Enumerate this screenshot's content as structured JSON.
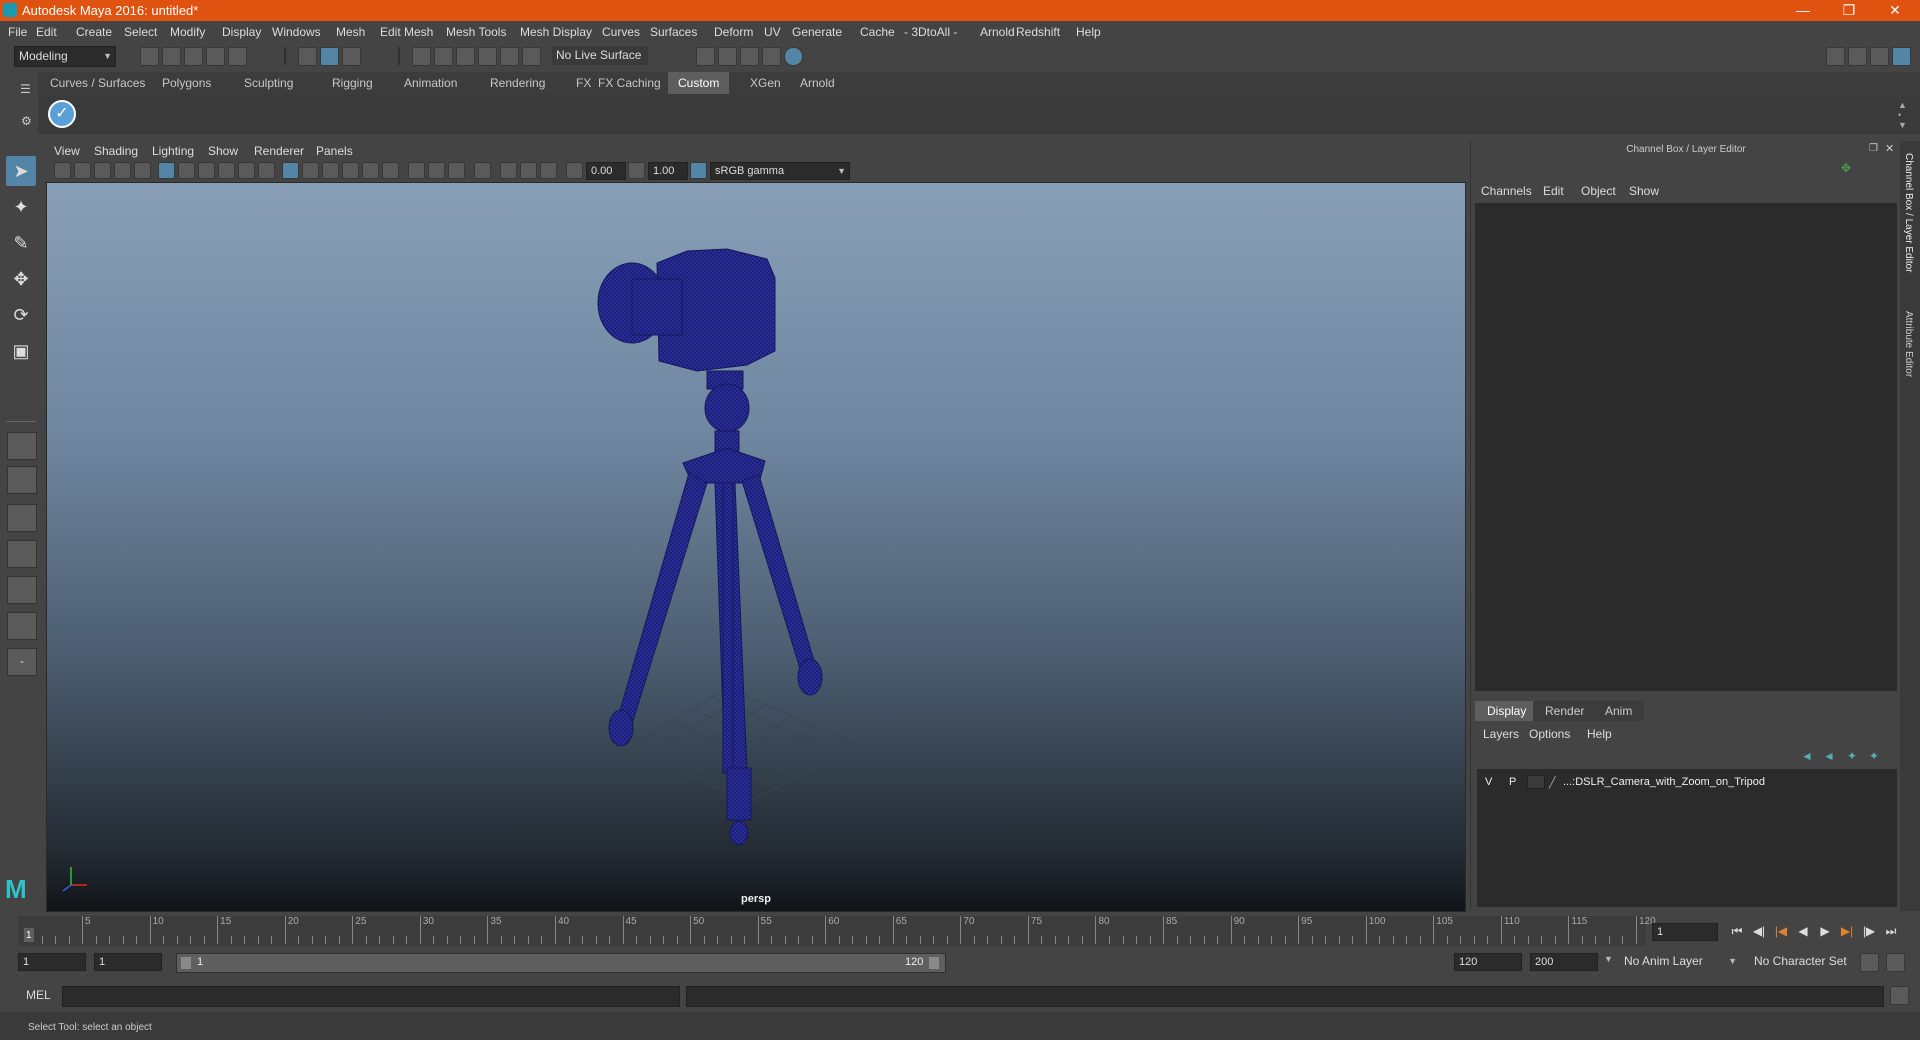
{
  "window": {
    "title": "Autodesk Maya 2016: untitled*"
  },
  "menubar": [
    "File",
    "Edit",
    "Create",
    "Select",
    "Modify",
    "Display",
    "Windows",
    "Mesh",
    "Edit Mesh",
    "Mesh Tools",
    "Mesh Display",
    "Curves",
    "Surfaces",
    "Deform",
    "UV",
    "Generate",
    "Cache",
    "- 3DtoAll -",
    "Arnold",
    "Redshift",
    "Help"
  ],
  "statusline": {
    "mode": "Modeling",
    "live_surface": "No Live Surface"
  },
  "shelf": {
    "tabs": [
      "Curves / Surfaces",
      "Polygons",
      "Sculpting",
      "Rigging",
      "Animation",
      "Rendering",
      "FX",
      "FX Caching",
      "Custom",
      "XGen",
      "Arnold"
    ],
    "active": "Custom"
  },
  "viewport": {
    "menu": [
      "View",
      "Shading",
      "Lighting",
      "Show",
      "Renderer",
      "Panels"
    ],
    "exposure": "0.00",
    "gamma": "1.00",
    "color_space": "sRGB gamma",
    "camera_label": "persp"
  },
  "channel_box": {
    "title": "Channel Box / Layer Editor",
    "menu": [
      "Channels",
      "Edit",
      "Object",
      "Show"
    ],
    "layer_tabs": [
      "Display",
      "Render",
      "Anim"
    ],
    "layer_menu": [
      "Layers",
      "Options",
      "Help"
    ],
    "layer": {
      "v": "V",
      "p": "P",
      "name": "...:DSLR_Camera_with_Zoom_on_Tripod"
    }
  },
  "edge_tabs": [
    "Channel Box / Layer Editor",
    "Attribute Editor"
  ],
  "timeline": {
    "ticks": [
      "5",
      "10",
      "15",
      "20",
      "25",
      "30",
      "35",
      "40",
      "45",
      "50",
      "55",
      "60",
      "65",
      "70",
      "75",
      "80",
      "85",
      "90",
      "95",
      "100",
      "105",
      "110",
      "115",
      "120"
    ],
    "current_marker": "1",
    "current_frame": "1"
  },
  "range": {
    "start": "1",
    "anim_start": "1",
    "slider_start": "1",
    "slider_end": "120",
    "end": "120",
    "anim_end": "200",
    "anim_layer": "No Anim Layer",
    "character_set": "No Character Set"
  },
  "command": {
    "lang": "MEL"
  },
  "help_line": "Select Tool: select an object",
  "colors": {
    "title_bar": "#e0520f",
    "selected": "#5285a6",
    "mesh": "#1c1f7a"
  }
}
